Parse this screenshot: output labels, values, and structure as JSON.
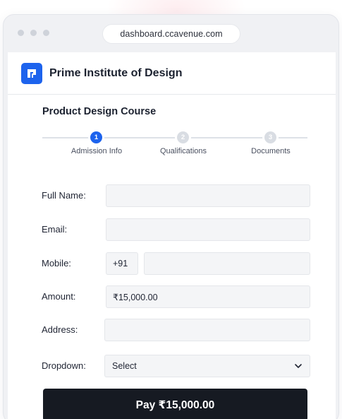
{
  "browser": {
    "url": "dashboard.ccavenue.com"
  },
  "header": {
    "org_name": "Prime Institute of Design",
    "logo_icon": "logo-icon",
    "brand_color": "#1d63ed"
  },
  "course": {
    "title": "Product Design Course"
  },
  "stepper": {
    "steps": [
      {
        "number": "1",
        "label": "Admission Info",
        "active": true
      },
      {
        "number": "2",
        "label": "Qualifications",
        "active": false
      },
      {
        "number": "3",
        "label": "Documents",
        "active": false
      }
    ]
  },
  "form": {
    "full_name": {
      "label": "Full Name:",
      "value": ""
    },
    "email": {
      "label": "Email:",
      "value": ""
    },
    "mobile": {
      "label": "Mobile:",
      "country_code": "+91",
      "value": ""
    },
    "amount": {
      "label": "Amount:",
      "value": "₹15,000.00"
    },
    "address": {
      "label": "Address:",
      "value": ""
    },
    "dropdown": {
      "label": "Dropdown:",
      "selected": "Select",
      "icon": "chevron-down-icon"
    }
  },
  "pay_button": {
    "label": "Pay ₹15,000.00",
    "color": "#161a22"
  }
}
